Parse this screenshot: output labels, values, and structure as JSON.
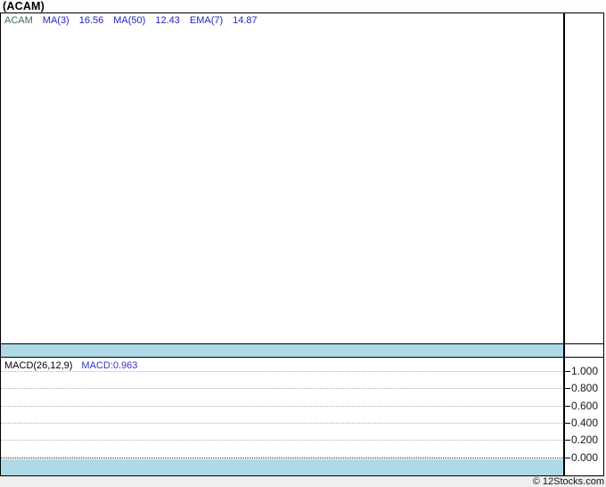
{
  "page": {
    "title": "(ACAM)",
    "copyright": "© 12Stocks.com"
  },
  "price_panel": {
    "legend": {
      "ticker": "ACAM",
      "items": [
        {
          "label": "MA(3)",
          "value": "16.56"
        },
        {
          "label": "MA(50)",
          "value": "12.43"
        },
        {
          "label": "EMA(7)",
          "value": "14.87"
        }
      ]
    }
  },
  "macd_panel": {
    "label": "MACD(26,12,9)",
    "value_label": "MACD:0.963",
    "axis_labels": [
      "1.000",
      "0.800",
      "0.600",
      "0.400",
      "0.200",
      "0.000"
    ]
  },
  "colors": {
    "ticker_text": "#3c6b5f",
    "indicator_text": "#2323cc",
    "macd_value_text": "#3333cc",
    "separator_band": "#aed9e6",
    "panel_border": "#000000",
    "gridline": "#b3b3b3",
    "zero_gridline": "#2a2a2a",
    "footer_background": "#efefef"
  },
  "chart_data": [
    {
      "type": "line",
      "panel": "price",
      "title": "(ACAM)",
      "legend_position": "top-left",
      "grid": false,
      "series": [
        {
          "name": "ACAM",
          "values": []
        },
        {
          "name": "MA(3)",
          "last_value": 16.56,
          "values": []
        },
        {
          "name": "MA(50)",
          "last_value": 12.43,
          "values": []
        },
        {
          "name": "EMA(7)",
          "last_value": 14.87,
          "values": []
        }
      ]
    },
    {
      "type": "line",
      "panel": "indicator",
      "title": "MACD(26,12,9)",
      "legend_position": "top-left",
      "grid": true,
      "ylim": [
        0.0,
        1.0
      ],
      "yticks": [
        1.0,
        0.8,
        0.6,
        0.4,
        0.2,
        0.0
      ],
      "series": [
        {
          "name": "MACD",
          "last_value": 0.963,
          "values": []
        }
      ]
    }
  ]
}
